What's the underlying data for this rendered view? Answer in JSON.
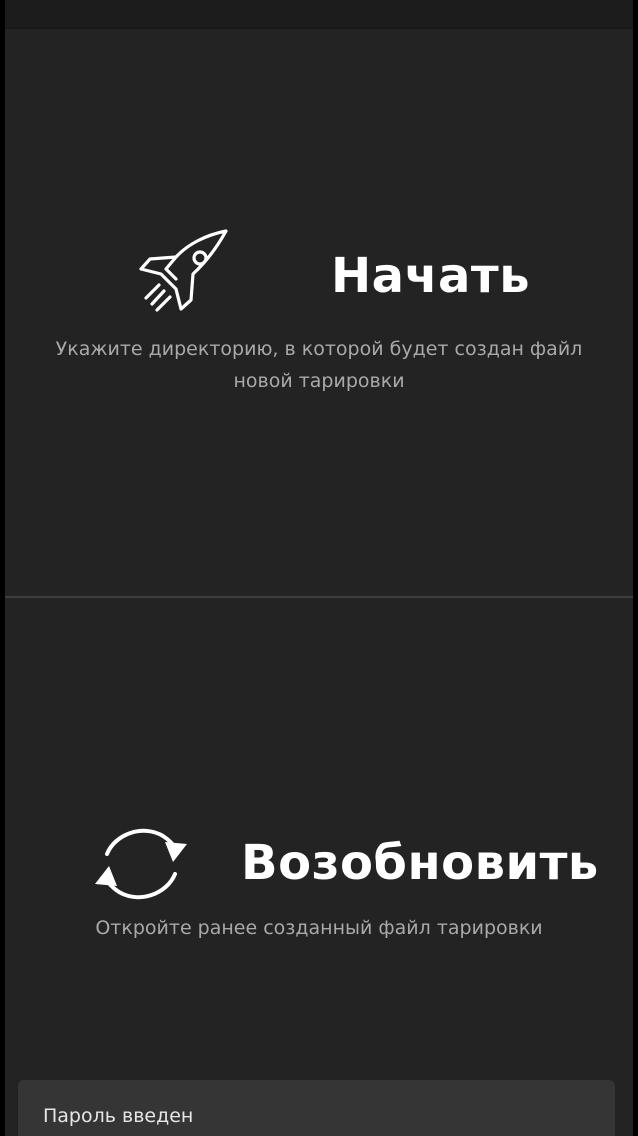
{
  "start": {
    "title": "Начать",
    "description": "Укажите директорию, в которой будет создан файл новой тарировки",
    "icon": "rocket-icon"
  },
  "resume": {
    "title": "Возобновить",
    "description": "Откройте ранее созданный файл тарировки",
    "icon": "refresh-icon"
  },
  "toast": {
    "message": "Пароль введен"
  },
  "colors": {
    "background": "#232323",
    "text": "#ffffff",
    "secondary_text": "#a9a9a9",
    "divider": "#3e3e3e",
    "toast_background": "#353535"
  }
}
